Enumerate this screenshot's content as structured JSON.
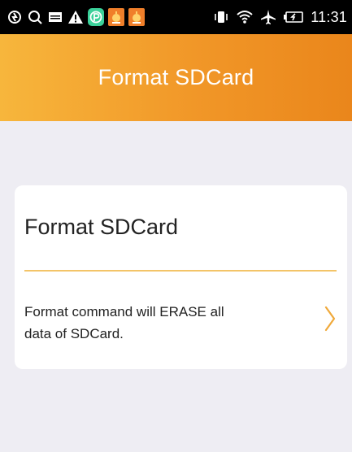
{
  "status_bar": {
    "time": "11:31",
    "left_icons": [
      "sync-icon",
      "search-icon",
      "gallery-icon",
      "warning-icon",
      "app-p-icon",
      "alarm-app-icon",
      "alarm-app-icon"
    ],
    "right_icons": [
      "vibrate-icon",
      "wifi-icon",
      "airplane-icon",
      "battery-charging-icon"
    ]
  },
  "header": {
    "title": "Format SDCard"
  },
  "card": {
    "title": "Format SDCard",
    "description_line1": "Format command will ERASE all",
    "description_line2": "data of SDCard."
  },
  "colors": {
    "header_gradient_start": "#f7b63c",
    "header_gradient_end": "#ea861b",
    "divider": "#f3c468",
    "chevron": "#f0a93a",
    "background": "#eeedf3"
  }
}
